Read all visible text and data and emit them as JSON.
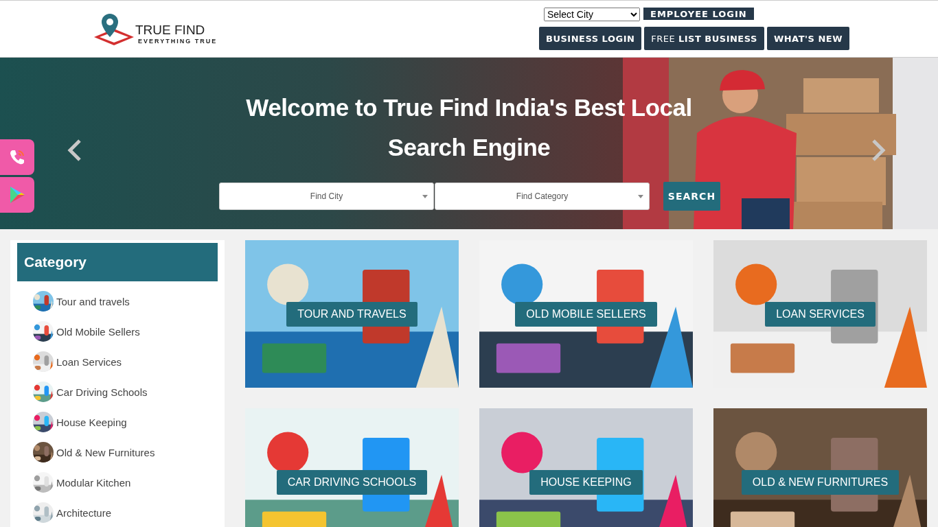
{
  "header": {
    "logo": {
      "title": "TRUE FIND",
      "tagline": "EVERYTHING TRUE"
    },
    "city_select": {
      "value": "Select City"
    },
    "employee_button": "EMPLOYEE LOGIN",
    "nav_buttons": [
      "BUSINESS LOGIN",
      "FREE **LIST BUSINESS**",
      "WHAT'S NEW"
    ]
  },
  "hero": {
    "heading": "Welcome to True Find India's Best Local Search Engine",
    "city_field": {
      "placeholder": "Find City"
    },
    "category_field": {
      "placeholder": "Find Category"
    },
    "search_button": "SEARCH"
  },
  "sidebar": {
    "title": "Category",
    "items": [
      {
        "label": "Tour and travels"
      },
      {
        "label": "Old Mobile Sellers"
      },
      {
        "label": "Loan Services"
      },
      {
        "label": "Car Driving Schools"
      },
      {
        "label": "House Keeping"
      },
      {
        "label": "Old & New Furnitures"
      },
      {
        "label": "Modular Kitchen"
      },
      {
        "label": "Architecture"
      }
    ]
  },
  "cards": [
    {
      "label": "TOUR AND TRAVELS"
    },
    {
      "label": "OLD MOBILE SELLERS"
    },
    {
      "label": "LOAN SERVICES"
    },
    {
      "label": "CAR DRIVING SCHOOLS"
    },
    {
      "label": "HOUSE KEEPING"
    },
    {
      "label": "OLD & NEW FURNITURES"
    }
  ]
}
